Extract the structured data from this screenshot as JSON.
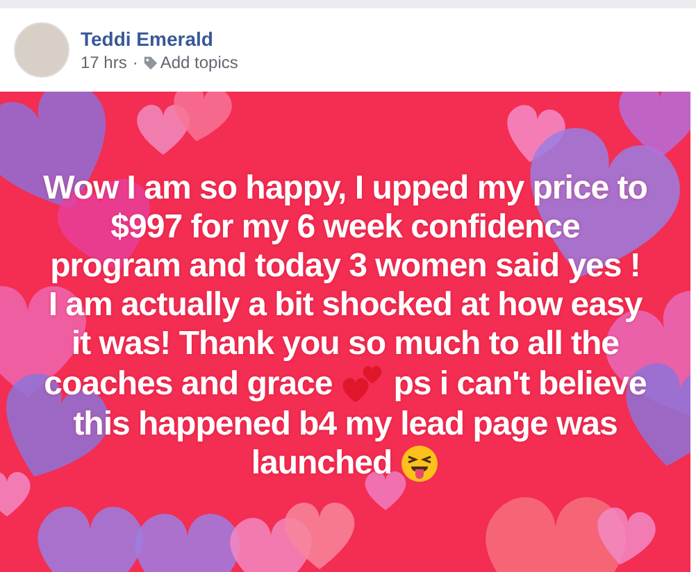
{
  "post": {
    "author": "Teddi Emerald",
    "time": "17 hrs",
    "separator": "·",
    "topics_link": "Add topics",
    "lines": [
      {
        "parts": [
          {
            "kind": "text",
            "text": "Wow I am so happy, I upped my price to"
          }
        ]
      },
      {
        "parts": [
          {
            "kind": "text",
            "text": "$997 for my 6 week confidence"
          }
        ]
      },
      {
        "parts": [
          {
            "kind": "text",
            "text": "program and today 3 women said yes !"
          }
        ]
      },
      {
        "parts": [
          {
            "kind": "text",
            "text": "I am actually a bit shocked at how easy"
          }
        ]
      },
      {
        "parts": [
          {
            "kind": "text",
            "text": "it was! Thank you so much to all the"
          }
        ]
      },
      {
        "parts": [
          {
            "kind": "text",
            "text": "coaches and grace"
          },
          {
            "kind": "hearts-emoji"
          },
          {
            "kind": "text",
            "text": "ps i can't believe"
          }
        ]
      },
      {
        "parts": [
          {
            "kind": "text",
            "text": "this happened b4 my lead page was"
          }
        ]
      },
      {
        "parts": [
          {
            "kind": "text",
            "text": "launched"
          },
          {
            "kind": "tongue-emoji"
          }
        ]
      }
    ]
  }
}
